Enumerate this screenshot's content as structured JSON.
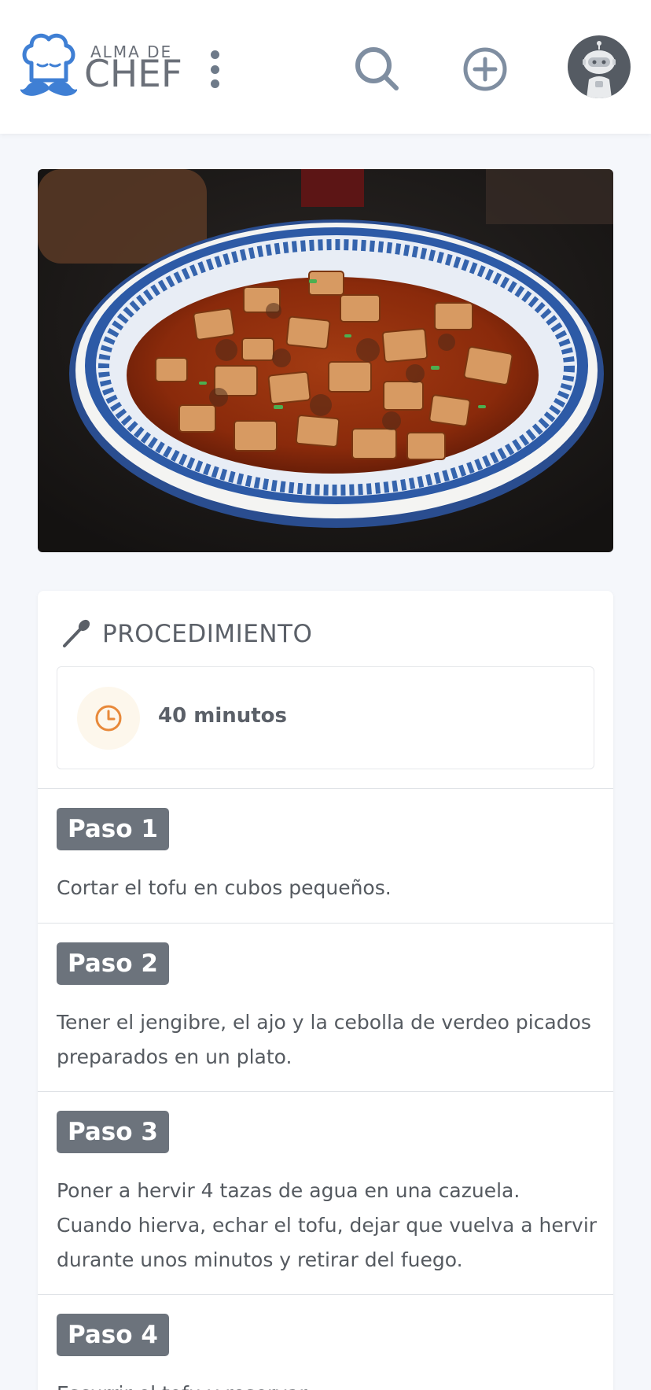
{
  "header": {
    "logo_small": "ALMA DE",
    "logo_big": "CHEF",
    "menu_icon": "kebab-menu-icon",
    "search_icon": "search-icon",
    "add_icon": "plus-circle-icon",
    "avatar_icon": "robot-avatar-icon"
  },
  "hero": {
    "image": "mapo-tofu-dish-photo"
  },
  "procedure": {
    "title": "PROCEDIMIENTO",
    "title_icon": "spoon-icon",
    "time_icon": "clock-icon",
    "time": "40 minutos",
    "steps": [
      {
        "label": "Paso 1",
        "text": "Cortar el tofu en cubos pequeños."
      },
      {
        "label": "Paso 2",
        "text": "Tener el jengibre, el ajo y la cebolla de verdeo picados preparados en un plato."
      },
      {
        "label": "Paso 3",
        "text": "Poner a hervir 4 tazas de agua en una cazuela. Cuando hierva, echar el tofu, dejar que vuelva a hervir durante unos minutos y retirar del fuego."
      },
      {
        "label": "Paso 4",
        "text": "Escurrir el tofu y reservar."
      }
    ]
  },
  "colors": {
    "accent_blue": "#3f7fd4",
    "badge_gray": "#6c737c",
    "clock_orange": "#e8893a"
  }
}
